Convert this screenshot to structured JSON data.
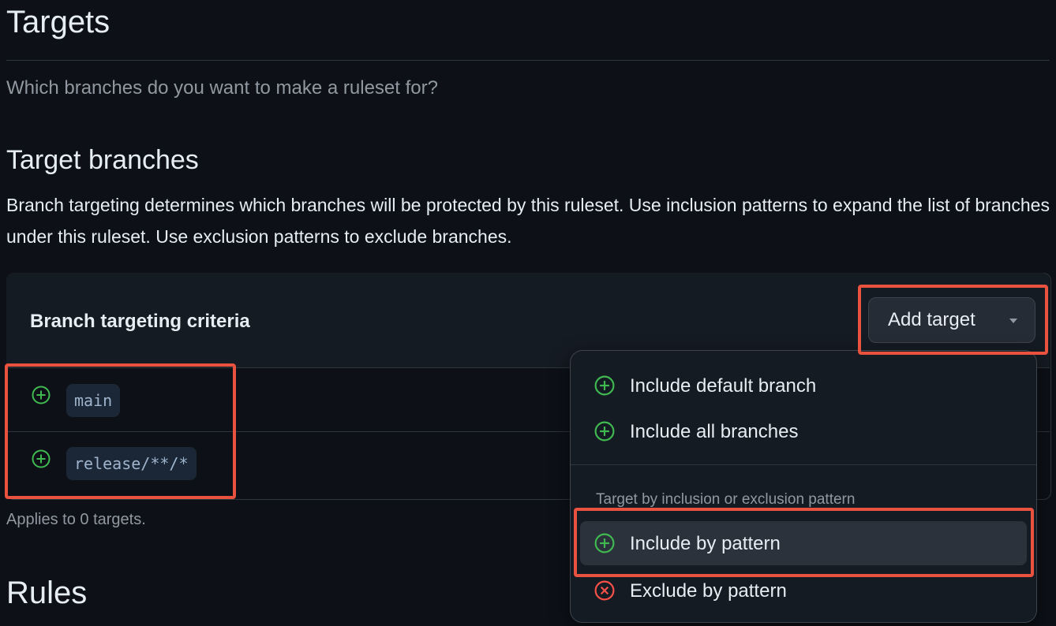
{
  "targets_section": {
    "title": "Targets",
    "subtitle": "Which branches do you want to make a ruleset for?"
  },
  "target_branches": {
    "title": "Target branches",
    "description": "Branch targeting determines which branches will be protected by this ruleset. Use inclusion patterns to expand the list of branches under this ruleset. Use exclusion patterns to exclude branches."
  },
  "criteria_panel": {
    "title": "Branch targeting criteria",
    "add_target_label": "Add target",
    "patterns": [
      {
        "icon": "plus-circle-icon",
        "value": "main"
      },
      {
        "icon": "plus-circle-icon",
        "value": "release/**/*"
      }
    ],
    "applies_text": "Applies to 0 targets."
  },
  "add_target_menu": {
    "items": [
      {
        "icon": "plus-circle-icon",
        "label": "Include default branch"
      },
      {
        "icon": "plus-circle-icon",
        "label": "Include all branches"
      }
    ],
    "group_label": "Target by inclusion or exclusion pattern",
    "pattern_items": [
      {
        "icon": "plus-circle-icon",
        "label": "Include by pattern",
        "active": true
      },
      {
        "icon": "x-circle-icon",
        "label": "Exclude by pattern"
      }
    ]
  },
  "rules_section": {
    "title": "Rules"
  },
  "colors": {
    "background": "#0d1117",
    "include_green": "#3fb950",
    "exclude_red": "#f85149",
    "highlight": "#e8523f"
  }
}
